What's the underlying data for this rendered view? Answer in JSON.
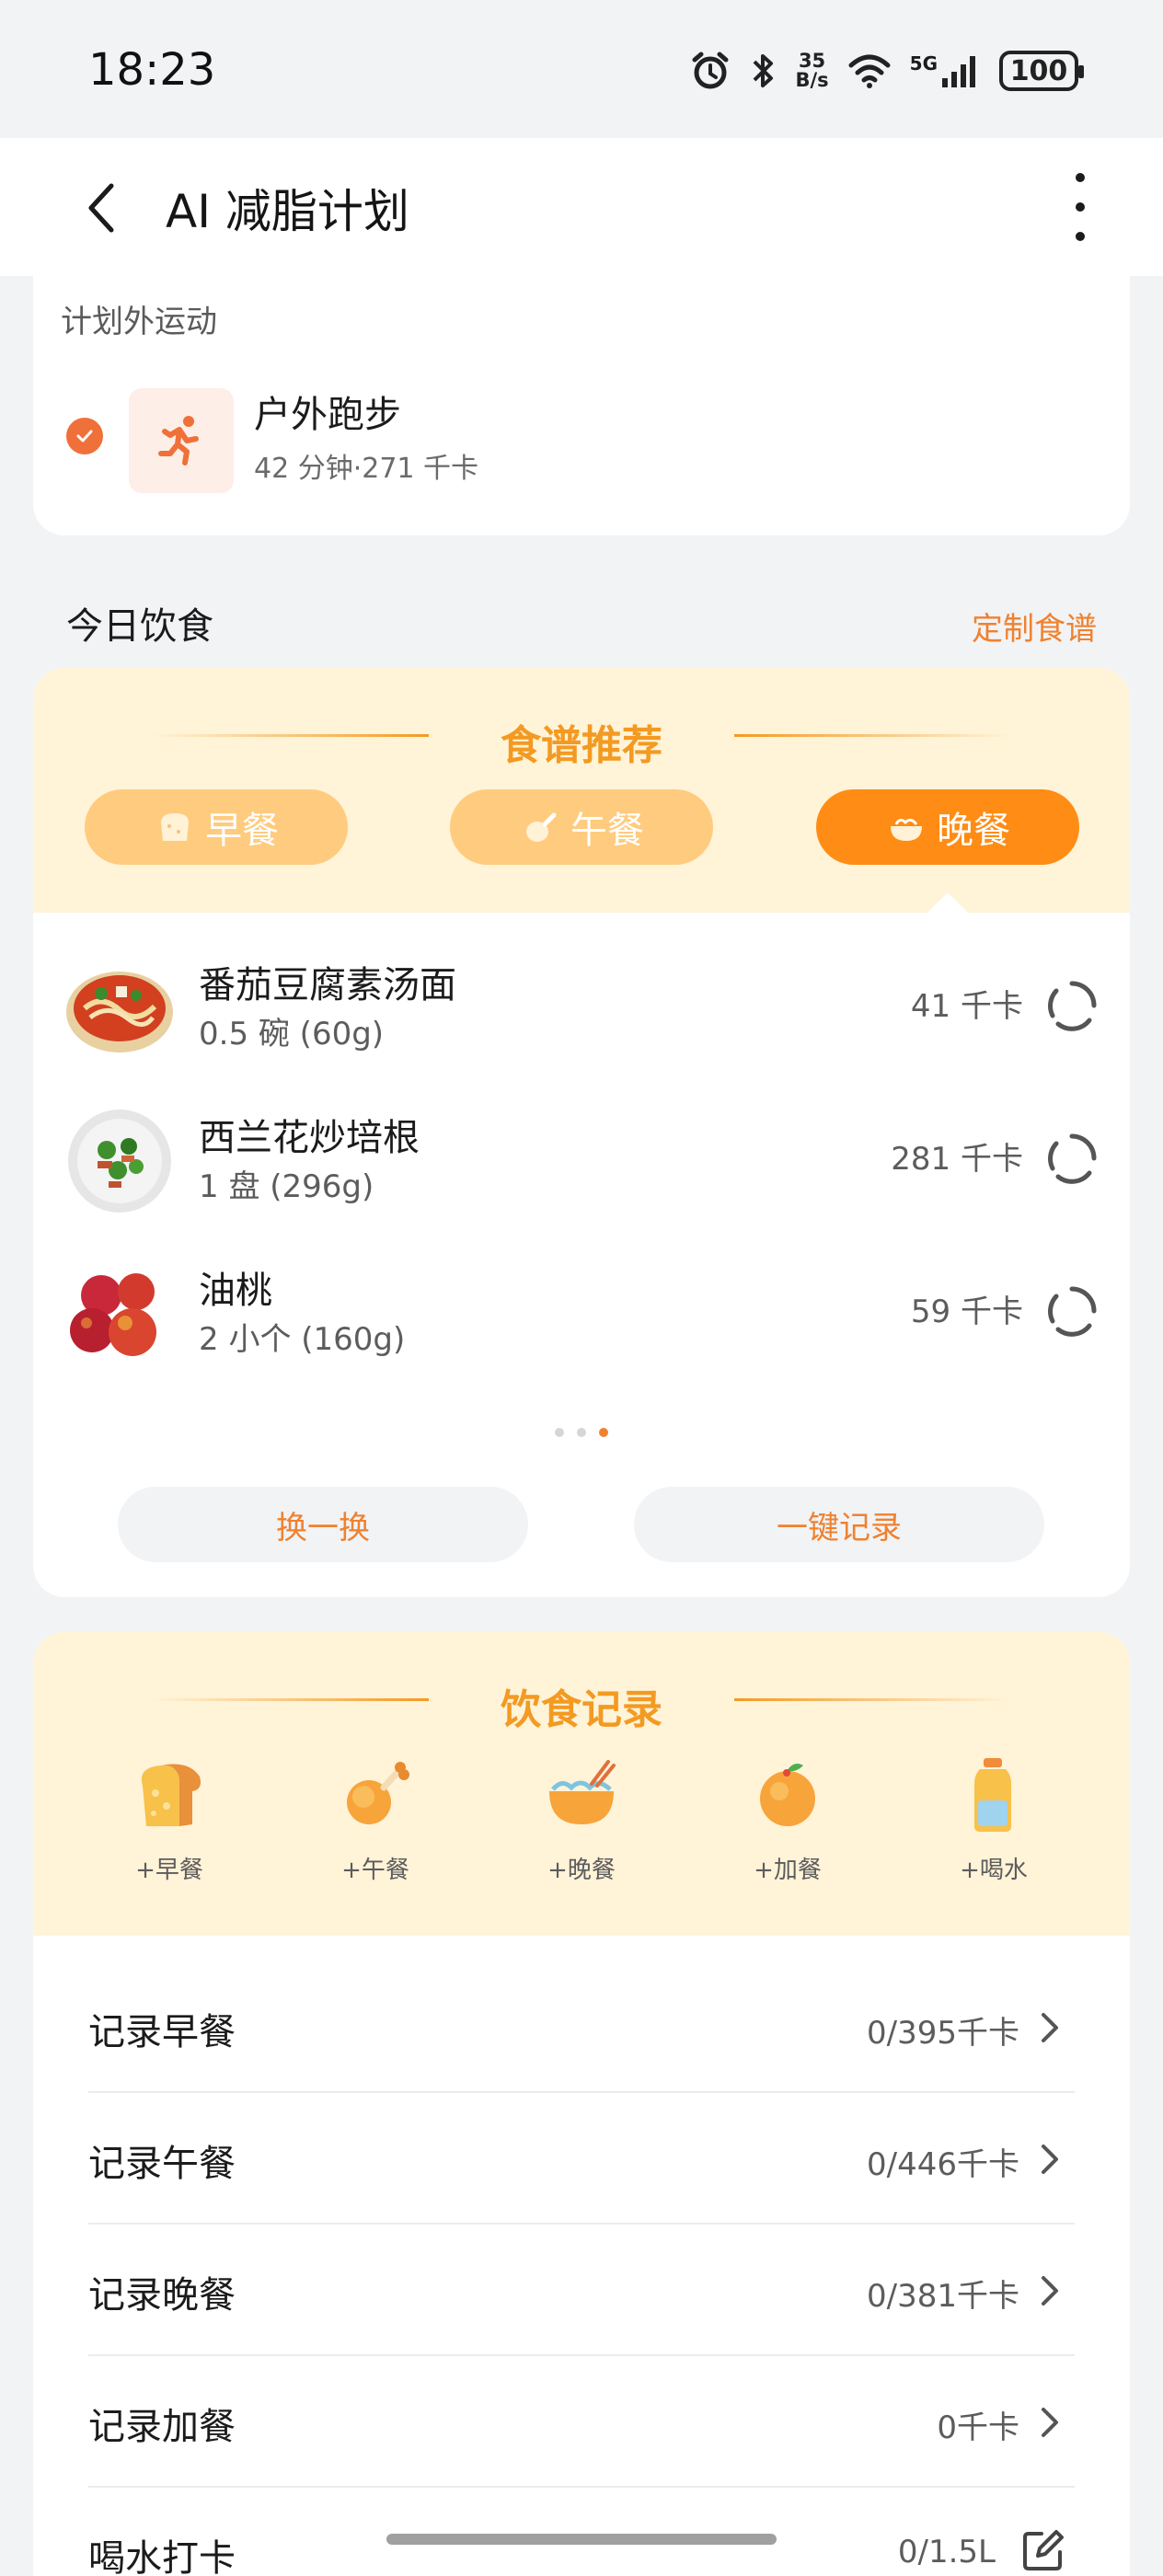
{
  "status_bar": {
    "time": "18:23",
    "net_speed_value": "35",
    "net_speed_unit": "B/s",
    "signal_label": "5G",
    "battery": "100",
    "icons": [
      "alarm-icon",
      "bluetooth-icon",
      "wifi-icon",
      "cellular-signal-icon",
      "battery-icon"
    ]
  },
  "header": {
    "title": "AI 减脂计划",
    "back_icon": "back-arrow-icon",
    "more_icon": "more-vertical-icon"
  },
  "extra_exercise": {
    "section_label": "计划外运动",
    "item": {
      "name": "户外跑步",
      "detail": "42 分钟·271 千卡",
      "checked": true,
      "icon": "running-icon"
    }
  },
  "today_diet": {
    "title": "今日饮食",
    "customize_link": "定制食谱"
  },
  "recipe_card": {
    "title": "食谱推荐",
    "tabs": [
      {
        "label": "早餐",
        "icon": "bread-icon",
        "active": false
      },
      {
        "label": "午餐",
        "icon": "drumstick-icon",
        "active": false
      },
      {
        "label": "晚餐",
        "icon": "bowl-icon",
        "active": true
      }
    ],
    "foods": [
      {
        "name": "番茄豆腐素汤面",
        "amount": "0.5 碗 (60g)",
        "kcal": "41 千卡",
        "image": "noodle-soup-image"
      },
      {
        "name": "西兰花炒培根",
        "amount": "1 盘 (296g)",
        "kcal": "281 千卡",
        "image": "broccoli-bacon-image"
      },
      {
        "name": "油桃",
        "amount": "2 小个 (160g)",
        "kcal": "59 千卡",
        "image": "nectarine-image"
      }
    ],
    "pagination": {
      "pages": 3,
      "current": 3
    },
    "buttons": {
      "swap": "换一换",
      "record_all": "一键记录"
    }
  },
  "diet_record": {
    "title": "饮食记录",
    "quick_add": [
      {
        "label": "+早餐",
        "icon": "toast-icon"
      },
      {
        "label": "+午餐",
        "icon": "drumstick-icon"
      },
      {
        "label": "+晚餐",
        "icon": "noodle-bowl-icon"
      },
      {
        "label": "+加餐",
        "icon": "orange-icon"
      },
      {
        "label": "+喝水",
        "icon": "water-bottle-icon"
      }
    ],
    "rows": [
      {
        "label": "记录早餐",
        "value": "0/395千卡"
      },
      {
        "label": "记录午餐",
        "value": "0/446千卡"
      },
      {
        "label": "记录晚餐",
        "value": "0/381千卡"
      },
      {
        "label": "记录加餐",
        "value": "0千卡"
      },
      {
        "label": "喝水打卡",
        "value": "0/1.5L"
      }
    ]
  },
  "colors": {
    "accent_orange": "#f0812e",
    "tab_active": "#ff8c14",
    "tab_inactive": "#ffcb7e",
    "header_cream": "#fff3d8",
    "title_gold": "#f39a22",
    "background": "#f1f3f5"
  }
}
